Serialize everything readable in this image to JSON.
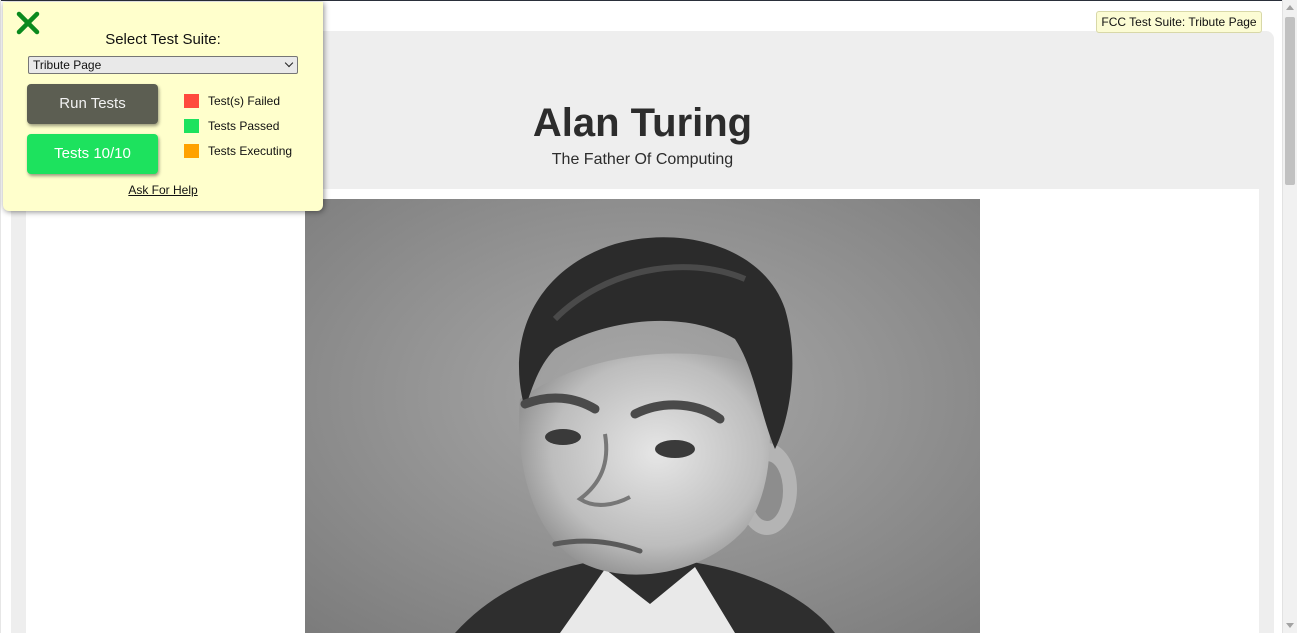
{
  "page": {
    "title": "Alan Turing",
    "subtitle": "The Father Of Computing"
  },
  "tooltip": {
    "text": "FCC Test Suite: Tribute Page"
  },
  "test_panel": {
    "select_label": "Select Test Suite:",
    "selected_suite": "Tribute Page",
    "run_button": "Run Tests",
    "tests_button": "Tests 10/10",
    "legend": [
      {
        "label": "Test(s) Failed",
        "color": "#ff4a3d"
      },
      {
        "label": "Tests Passed",
        "color": "#1de25e"
      },
      {
        "label": "Tests Executing",
        "color": "#ffa200"
      }
    ],
    "help_link": "Ask For Help",
    "close_icon_color": "#0a8a1e"
  },
  "icons": {
    "close": "close-icon",
    "dropdown": "chevron-down-icon"
  }
}
